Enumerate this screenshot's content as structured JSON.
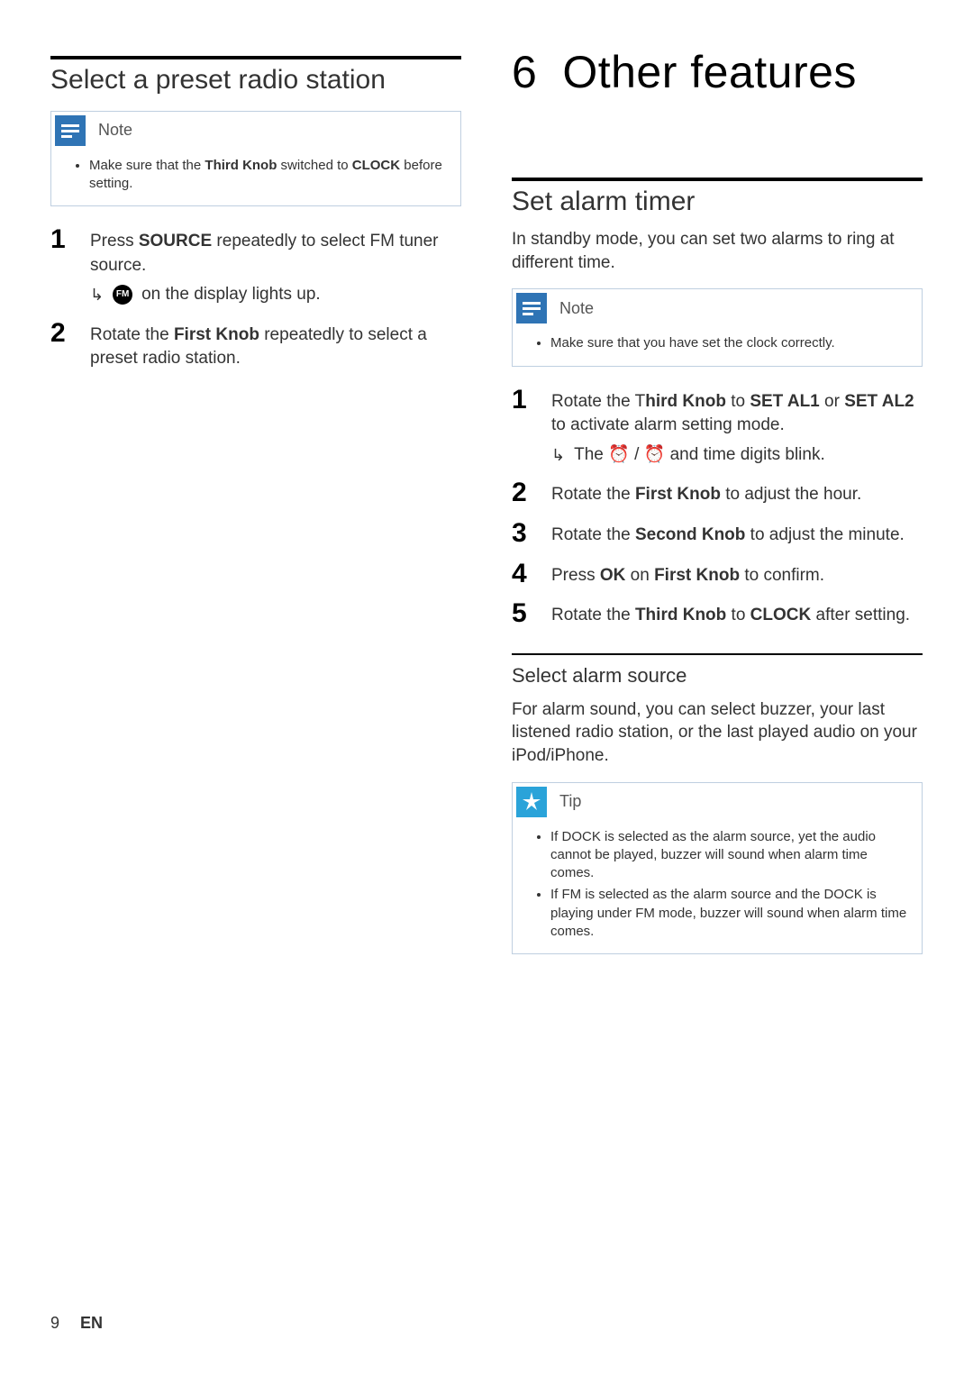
{
  "left": {
    "section_title": "Select a preset radio station",
    "note": {
      "label": "Note",
      "items": [
        {
          "pre": "Make sure that the ",
          "b1": "Third Knob",
          "mid": " switched to ",
          "b2": "CLOCK",
          "post": " before setting."
        }
      ]
    },
    "steps": [
      {
        "num": "1",
        "parts": {
          "pre": "Press ",
          "b1": "SOURCE",
          "post": " repeatedly to select FM tuner source."
        },
        "result": {
          "badge": "FM",
          "text": " on the display lights up."
        }
      },
      {
        "num": "2",
        "parts": {
          "pre": "Rotate the ",
          "b1": "First Knob",
          "post": " repeatedly to select a preset radio station."
        }
      }
    ]
  },
  "right": {
    "chapter_num": "6",
    "chapter_title": "Other features",
    "section_title": "Set alarm timer",
    "intro": "In standby mode, you can set two alarms to ring at different time.",
    "note": {
      "label": "Note",
      "items": [
        {
          "text": "Make sure that you have set the clock correctly."
        }
      ]
    },
    "steps": [
      {
        "num": "1",
        "parts": {
          "pre": "Rotate the T",
          "b1": "hird Knob",
          "mid": " to ",
          "b2": "SET AL1",
          "mid2": " or ",
          "b3": "SET AL2",
          "post": " to activate alarm setting mode."
        },
        "result": {
          "text_pre": "The ",
          "text_post": " and time digits blink."
        }
      },
      {
        "num": "2",
        "parts": {
          "pre": "Rotate the ",
          "b1": "First Knob",
          "post": " to adjust the hour."
        }
      },
      {
        "num": "3",
        "parts": {
          "pre": "Rotate the ",
          "b1": "Second Knob",
          "post": " to adjust the minute."
        }
      },
      {
        "num": "4",
        "parts": {
          "pre": "Press ",
          "b1": "OK",
          "mid": " on ",
          "b2": "First Knob",
          "post": " to confirm."
        }
      },
      {
        "num": "5",
        "parts": {
          "pre": "Rotate the ",
          "b1": "Third Knob",
          "mid": " to ",
          "b2": "CLOCK",
          "post": " after setting."
        }
      }
    ],
    "subsection_title": "Select alarm source",
    "sub_intro": "For alarm sound, you can select buzzer, your last listened radio station, or the last played audio on your iPod/iPhone.",
    "tip": {
      "label": "Tip",
      "items": [
        {
          "text": "If DOCK is selected as the alarm source, yet the audio cannot be played, buzzer will sound when alarm time comes."
        },
        {
          "text": "If FM is selected as the alarm source and the DOCK is playing under FM mode, buzzer will sound when alarm time comes."
        }
      ]
    }
  },
  "footer": {
    "page": "9",
    "lang": "EN"
  }
}
